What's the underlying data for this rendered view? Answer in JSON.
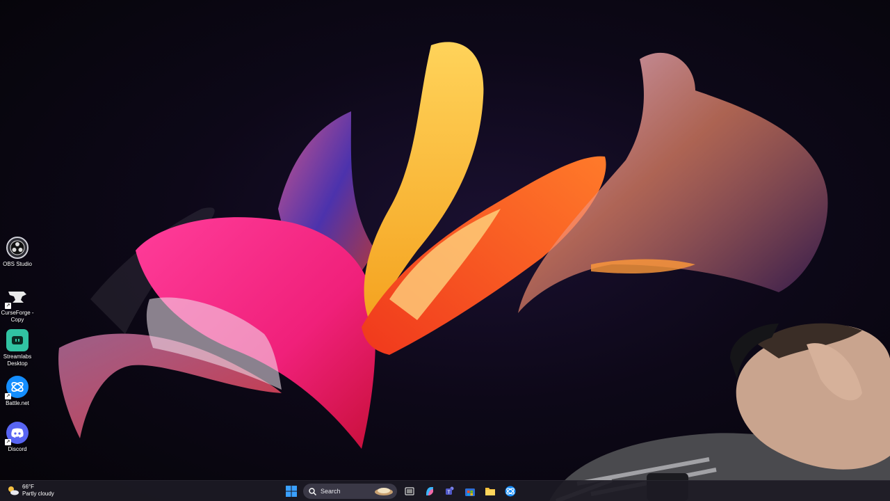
{
  "desktop_icons": [
    {
      "label": "OBS Studio",
      "icon": "obs-studio-icon"
    },
    {
      "label": "CurseForge -\nCopy",
      "icon": "curseforge-icon"
    },
    {
      "label": "Streamlabs\nDesktop",
      "icon": "streamlabs-icon"
    },
    {
      "label": "Battle.net",
      "icon": "battlenet-icon"
    },
    {
      "label": "Discord",
      "icon": "discord-icon"
    }
  ],
  "taskbar": {
    "weather": {
      "temperature": "66°F",
      "condition": "Partly cloudy",
      "icon": "partly-cloudy-icon"
    },
    "search": {
      "label": "Search",
      "icon": "search-icon"
    },
    "apps": [
      {
        "name": "start",
        "icon": "windows-start-icon"
      },
      {
        "name": "task-view",
        "icon": "task-view-icon"
      },
      {
        "name": "copilot",
        "icon": "copilot-icon"
      },
      {
        "name": "teams",
        "icon": "teams-icon"
      },
      {
        "name": "store",
        "icon": "microsoft-store-icon"
      },
      {
        "name": "file-explorer",
        "icon": "folder-icon"
      },
      {
        "name": "battlenet",
        "icon": "battlenet-icon"
      }
    ]
  },
  "colors": {
    "taskbar_bg": "#1c1a24",
    "discord": "#5865f2",
    "streamlabs": "#31c3a2",
    "battlenet": "#148eff"
  }
}
